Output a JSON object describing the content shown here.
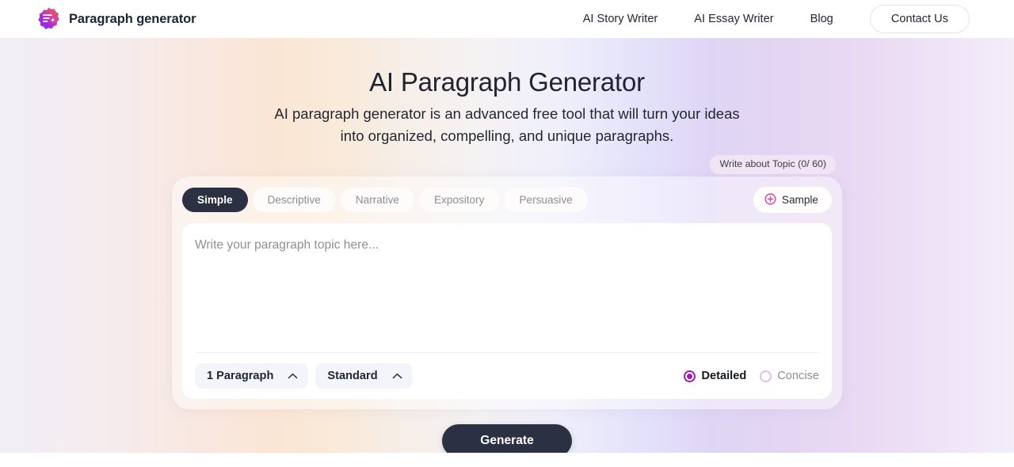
{
  "header": {
    "logo_icon": "paragraph-sparkle-logo-icon",
    "brand": "Paragraph generator",
    "nav": [
      {
        "label": "AI Story Writer"
      },
      {
        "label": "AI Essay Writer"
      },
      {
        "label": "Blog"
      }
    ],
    "cta_label": "Contact Us"
  },
  "hero": {
    "title": "AI Paragraph Generator",
    "subtitle": "AI paragraph generator is an advanced free tool that will turn your ideas into organized, compelling, and unique paragraphs."
  },
  "topic_badge": {
    "label": "Write about Topic (0/ 60)",
    "count": 0,
    "max": 60
  },
  "card": {
    "tabs": [
      {
        "label": "Simple",
        "active": true
      },
      {
        "label": "Descriptive",
        "active": false
      },
      {
        "label": "Narrative",
        "active": false
      },
      {
        "label": "Expository",
        "active": false
      },
      {
        "label": "Persuasive",
        "active": false
      }
    ],
    "sample": {
      "icon": "plus-circle-icon",
      "label": "Sample"
    },
    "input": {
      "value": "",
      "placeholder": "Write your paragraph topic here..."
    },
    "controls": {
      "length_select": {
        "value": "1 Paragraph",
        "icon": "chevron-up-icon"
      },
      "style_select": {
        "value": "Standard",
        "icon": "chevron-up-icon"
      },
      "mode_radios": [
        {
          "label": "Detailed",
          "selected": true
        },
        {
          "label": "Concise",
          "selected": false
        }
      ]
    }
  },
  "generate_button": {
    "label": "Generate"
  },
  "colors": {
    "dark": "#2b3142",
    "accent_purple": "#a21caf",
    "accent_pink": "#d6409f",
    "badge_bg": "#f0e4f5",
    "divider": "#eceafb"
  }
}
